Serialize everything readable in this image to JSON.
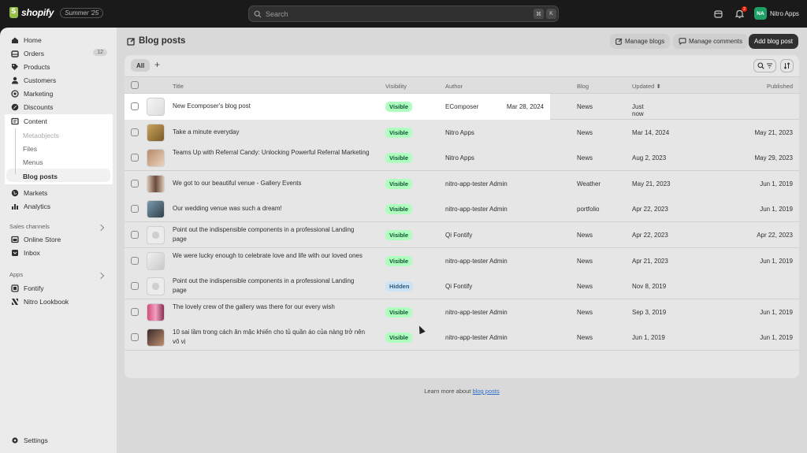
{
  "topbar": {
    "brand": "shopify",
    "edition": "Summer '25",
    "search_placeholder": "Search",
    "kbd1": "⌘",
    "kbd2": "K",
    "notif_count": "2",
    "user_initials": "NA",
    "user_name": "Nitro Apps"
  },
  "sidebar": {
    "items": [
      {
        "label": "Home",
        "icon": "home-icon"
      },
      {
        "label": "Orders",
        "icon": "orders-icon",
        "badge": "12"
      },
      {
        "label": "Products",
        "icon": "tag-icon"
      },
      {
        "label": "Customers",
        "icon": "person-icon"
      },
      {
        "label": "Marketing",
        "icon": "target-icon"
      },
      {
        "label": "Discounts",
        "icon": "discount-icon"
      },
      {
        "label": "Content",
        "icon": "content-icon"
      }
    ],
    "content_sub": [
      "Metaobjects",
      "Files",
      "Menus",
      "Blog posts"
    ],
    "items2": [
      {
        "label": "Markets",
        "icon": "globe-icon"
      },
      {
        "label": "Analytics",
        "icon": "chart-icon"
      }
    ],
    "sales_channels_title": "Sales channels",
    "sales_channels": [
      {
        "label": "Online Store",
        "icon": "store-icon"
      },
      {
        "label": "Inbox",
        "icon": "inbox-icon"
      }
    ],
    "apps_title": "Apps",
    "apps": [
      {
        "label": "Fontify",
        "icon": "app-icon"
      },
      {
        "label": "Nitro Lookbook",
        "icon": "nitro-icon"
      }
    ],
    "settings": "Settings"
  },
  "page": {
    "title": "Blog posts",
    "manage_blogs": "Manage blogs",
    "manage_comments": "Manage comments",
    "add_blog_post": "Add blog post",
    "tab_all": "All",
    "tab_add": "+",
    "learn_prefix": "Learn more about ",
    "learn_link": "blog posts"
  },
  "table": {
    "headers": {
      "title": "Title",
      "visibility": "Visibility",
      "author": "Author",
      "blog": "Blog",
      "updated": "Updated",
      "published": "Published"
    },
    "rows": [
      {
        "title": "New Ecomposer's blog post",
        "visibility": "Visible",
        "author": "EComposer",
        "blog": "News",
        "updated": "Just now",
        "published": "Mar 28, 2024"
      },
      {
        "title": "Take a minute everyday",
        "visibility": "Visible",
        "author": "Nitro Apps",
        "blog": "News",
        "updated": "Mar 14, 2024",
        "published": "May 21, 2023"
      },
      {
        "title": "Teams Up with Referral Candy: Unlocking Powerful Referral Marketing",
        "visibility": "Visible",
        "author": "Nitro Apps",
        "blog": "News",
        "updated": "Aug 2, 2023",
        "published": "May 29, 2023"
      },
      {
        "title": "We got to our beautiful venue - Gallery Events",
        "visibility": "Visible",
        "author": "nitro-app-tester Admin",
        "blog": "Weather",
        "updated": "May 21, 2023",
        "published": "Jun 1, 2019"
      },
      {
        "title": "Our wedding venue was such a dream!",
        "visibility": "Visible",
        "author": "nitro-app-tester Admin",
        "blog": "portfolio",
        "updated": "Apr 22, 2023",
        "published": "Jun 1, 2019"
      },
      {
        "title": "Point out the indispensible components in a professional Landing page",
        "visibility": "Visible",
        "author": "Qi Fontify",
        "blog": "News",
        "updated": "Apr 22, 2023",
        "published": "Apr 22, 2023"
      },
      {
        "title": "We were lucky enough to celebrate love and life with our loved ones",
        "visibility": "Visible",
        "author": "nitro-app-tester Admin",
        "blog": "News",
        "updated": "Apr 21, 2023",
        "published": "Jun 1, 2019"
      },
      {
        "title": "Point out the indispensible components in a professional Landing page",
        "visibility": "Hidden",
        "author": "Qi Fontify",
        "blog": "News",
        "updated": "Nov 8, 2019",
        "published": ""
      },
      {
        "title": "The lovely crew of the gallery was there for our every wish",
        "visibility": "Visible",
        "author": "nitro-app-tester Admin",
        "blog": "News",
        "updated": "Sep 3, 2019",
        "published": "Jun 1, 2019"
      },
      {
        "title": "10 sai lầm trong cách ăn mặc khiến cho tủ quần áo của nàng trở nên vô vị",
        "visibility": "Visible",
        "author": "nitro-app-tester Admin",
        "blog": "News",
        "updated": "Jun 1, 2019",
        "published": "Jun 1, 2019"
      }
    ]
  },
  "colors": {
    "brand": "#95bf47",
    "visible_badge": "#affebf",
    "hidden_badge": "#cbe3f5",
    "primary_button": "#303030"
  }
}
